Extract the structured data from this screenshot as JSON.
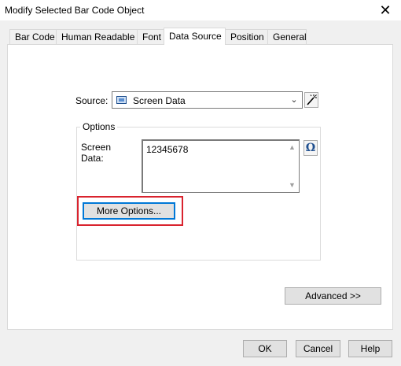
{
  "window": {
    "title": "Modify Selected Bar Code Object",
    "close_glyph": "✕"
  },
  "tabs": [
    {
      "label": "Bar Code"
    },
    {
      "label": "Human Readable"
    },
    {
      "label": "Font"
    },
    {
      "label": "Data Source",
      "active": true
    },
    {
      "label": "Position"
    },
    {
      "label": "General"
    }
  ],
  "source": {
    "label": "Source:",
    "value": "Screen Data",
    "icon": "screen-data-icon"
  },
  "options": {
    "group_label": "Options",
    "screen_data_label": "Screen Data:",
    "screen_data_value": "12345678",
    "more_options_label": "More Options..."
  },
  "buttons": {
    "advanced": "Advanced >>",
    "ok": "OK",
    "cancel": "Cancel",
    "help": "Help"
  },
  "colors": {
    "highlight": "#d9232e",
    "focus": "#0078d7"
  }
}
